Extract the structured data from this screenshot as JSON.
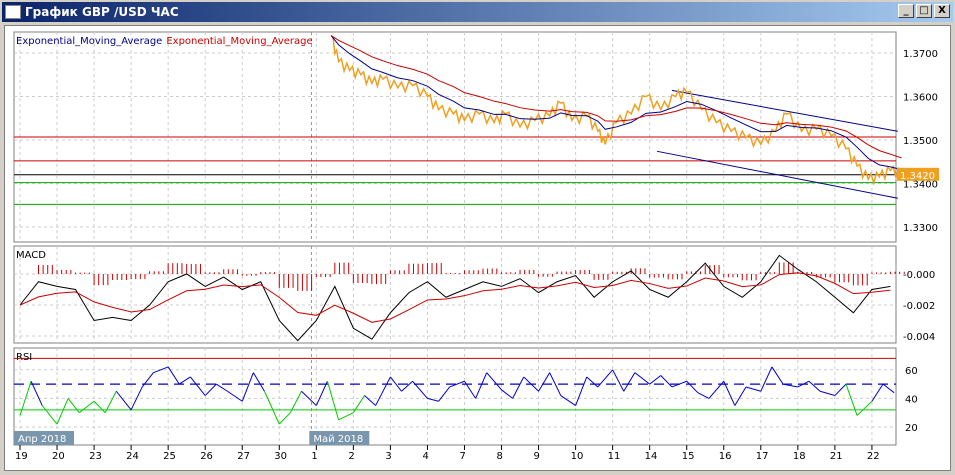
{
  "window": {
    "title": "График GBP /USD  ЧАС",
    "minimize": "_",
    "maximize": "□",
    "close": "X"
  },
  "main": {
    "legend": [
      {
        "text": "Exponential_Moving_Average",
        "color": "#00008b"
      },
      {
        "text": "Exponential_Moving_Average",
        "color": "#cc0000"
      }
    ],
    "y_ticks": [
      "1.3700",
      "1.3600",
      "1.3500",
      "1.3400",
      "1.3300"
    ],
    "current_price": "1.3420"
  },
  "macd": {
    "label": "MACD",
    "y_ticks": [
      "-0.000",
      "-0.002",
      "-0.004"
    ]
  },
  "rsi": {
    "label": "RSI",
    "y_ticks": [
      "60",
      "40",
      "20"
    ]
  },
  "x_axis": {
    "ticks": [
      "19",
      "20",
      "23",
      "24",
      "25",
      "26",
      "27",
      "30",
      "1",
      "2",
      "3",
      "4",
      "7",
      "8",
      "9",
      "10",
      "11",
      "14",
      "15",
      "16",
      "17",
      "18",
      "21",
      "22"
    ],
    "month_labels": [
      {
        "text": "Апр 2018",
        "idx": 0
      },
      {
        "text": "Май 2018",
        "idx": 8
      }
    ]
  },
  "chart_data": [
    {
      "type": "line",
      "title": "GBP/USD H1",
      "ylim": [
        1.325,
        1.374
      ],
      "price": [
        [
          8.4,
          1.374
        ],
        [
          8.6,
          1.368
        ],
        [
          8.9,
          1.366
        ],
        [
          9.2,
          1.365
        ],
        [
          9.5,
          1.363
        ],
        [
          9.8,
          1.364
        ],
        [
          10.2,
          1.362
        ],
        [
          10.6,
          1.3625
        ],
        [
          11,
          1.36
        ],
        [
          11.3,
          1.357
        ],
        [
          11.7,
          1.356
        ],
        [
          12,
          1.3545
        ],
        [
          12.4,
          1.356
        ],
        [
          12.8,
          1.354
        ],
        [
          13.1,
          1.356
        ],
        [
          13.5,
          1.353
        ],
        [
          13.9,
          1.3545
        ],
        [
          14.3,
          1.3555
        ],
        [
          14.6,
          1.3585
        ],
        [
          14.9,
          1.3545
        ],
        [
          15.3,
          1.3555
        ],
        [
          15.6,
          1.352
        ],
        [
          15.8,
          1.349
        ],
        [
          16.1,
          1.354
        ],
        [
          16.5,
          1.356
        ],
        [
          16.9,
          1.36
        ],
        [
          17.3,
          1.357
        ],
        [
          17.7,
          1.36
        ],
        [
          18,
          1.361
        ],
        [
          18.4,
          1.357
        ],
        [
          18.8,
          1.354
        ],
        [
          19.2,
          1.352
        ],
        [
          19.6,
          1.3505
        ],
        [
          20,
          1.349
        ],
        [
          20.4,
          1.352
        ],
        [
          20.7,
          1.356
        ],
        [
          21.1,
          1.352
        ],
        [
          21.5,
          1.3525
        ],
        [
          21.9,
          1.351
        ],
        [
          22.3,
          1.348
        ],
        [
          22.6,
          1.344
        ],
        [
          22.9,
          1.341
        ],
        [
          23.2,
          1.3415
        ],
        [
          23.5,
          1.343
        ],
        [
          23.8,
          1.342
        ]
      ],
      "hlines": [
        {
          "value": 1.3507,
          "color": "#cc0000"
        },
        {
          "value": 1.3452,
          "color": "#cc0000"
        },
        {
          "value": 1.342,
          "color": "#000000"
        },
        {
          "value": 1.3402,
          "color": "#00aa00"
        },
        {
          "value": 1.3352,
          "color": "#00aa00"
        }
      ],
      "trendlines": [
        {
          "from": [
            17.6,
            1.3614
          ],
          "to": [
            23.7,
            1.352
          ],
          "color": "#00008b"
        },
        {
          "from": [
            17.2,
            1.3474
          ],
          "to": [
            23.7,
            1.3366
          ],
          "color": "#00008b"
        }
      ]
    },
    {
      "type": "line",
      "title": "MACD",
      "ylim": [
        -0.0043,
        0.0008
      ],
      "macd": [
        [
          0,
          -0.002
        ],
        [
          0.5,
          -0.0005
        ],
        [
          1,
          -0.0008
        ],
        [
          1.5,
          -0.001
        ],
        [
          2,
          -0.003
        ],
        [
          2.5,
          -0.0028
        ],
        [
          3,
          -0.003
        ],
        [
          3.5,
          -0.002
        ],
        [
          4,
          -0.0005
        ],
        [
          4.5,
          0
        ],
        [
          5,
          -0.0008
        ],
        [
          5.5,
          -0.0002
        ],
        [
          6,
          -0.001
        ],
        [
          6.5,
          -0.0005
        ],
        [
          7,
          -0.003
        ],
        [
          7.5,
          -0.0043
        ],
        [
          8,
          -0.003
        ],
        [
          8.5,
          -0.0008
        ],
        [
          9,
          -0.0035
        ],
        [
          9.5,
          -0.0042
        ],
        [
          10,
          -0.0025
        ],
        [
          10.5,
          -0.0012
        ],
        [
          11,
          -0.0005
        ],
        [
          11.5,
          -0.0015
        ],
        [
          12,
          -0.001
        ],
        [
          12.5,
          -0.0005
        ],
        [
          13,
          -0.0008
        ],
        [
          13.5,
          -0.0003
        ],
        [
          14,
          -0.0012
        ],
        [
          14.5,
          -0.0005
        ],
        [
          15,
          -0.0001
        ],
        [
          15.5,
          -0.0015
        ],
        [
          16,
          -0.0005
        ],
        [
          16.5,
          0.0002
        ],
        [
          17,
          -0.001
        ],
        [
          17.5,
          -0.0015
        ],
        [
          18,
          -0.0005
        ],
        [
          18.5,
          0.0007
        ],
        [
          19,
          -0.0008
        ],
        [
          19.5,
          -0.0015
        ],
        [
          20,
          -0.0005
        ],
        [
          20.5,
          0.0012
        ],
        [
          21,
          0.0003
        ],
        [
          21.5,
          -0.0005
        ],
        [
          22,
          -0.0015
        ],
        [
          22.5,
          -0.0025
        ],
        [
          23,
          -0.001
        ],
        [
          23.5,
          -0.0008
        ]
      ]
    },
    {
      "type": "line",
      "title": "RSI",
      "ylim": [
        15,
        70
      ],
      "levels": [
        {
          "value": 70,
          "color": "#cc0000"
        },
        {
          "value": 50,
          "color": "#0000cc",
          "dashed": true
        },
        {
          "value": 30,
          "color": "#00cc00"
        }
      ],
      "rsi": [
        [
          0,
          28
        ],
        [
          0.3,
          52
        ],
        [
          0.6,
          35
        ],
        [
          1,
          22
        ],
        [
          1.3,
          40
        ],
        [
          1.6,
          30
        ],
        [
          2,
          38
        ],
        [
          2.3,
          30
        ],
        [
          2.6,
          45
        ],
        [
          3,
          32
        ],
        [
          3.3,
          48
        ],
        [
          3.6,
          58
        ],
        [
          4,
          62
        ],
        [
          4.3,
          50
        ],
        [
          4.6,
          55
        ],
        [
          5,
          42
        ],
        [
          5.3,
          50
        ],
        [
          5.6,
          45
        ],
        [
          6,
          38
        ],
        [
          6.3,
          58
        ],
        [
          6.6,
          45
        ],
        [
          7,
          22
        ],
        [
          7.3,
          30
        ],
        [
          7.6,
          45
        ],
        [
          8,
          35
        ],
        [
          8.3,
          52
        ],
        [
          8.6,
          25
        ],
        [
          9,
          30
        ],
        [
          9.3,
          42
        ],
        [
          9.6,
          35
        ],
        [
          10,
          55
        ],
        [
          10.3,
          45
        ],
        [
          10.6,
          52
        ],
        [
          11,
          40
        ],
        [
          11.3,
          38
        ],
        [
          11.6,
          48
        ],
        [
          12,
          52
        ],
        [
          12.3,
          40
        ],
        [
          12.6,
          58
        ],
        [
          13,
          46
        ],
        [
          13.3,
          40
        ],
        [
          13.6,
          55
        ],
        [
          14,
          45
        ],
        [
          14.3,
          58
        ],
        [
          14.6,
          42
        ],
        [
          15,
          35
        ],
        [
          15.3,
          55
        ],
        [
          15.6,
          48
        ],
        [
          16,
          60
        ],
        [
          16.3,
          45
        ],
        [
          16.6,
          58
        ],
        [
          17,
          50
        ],
        [
          17.3,
          56
        ],
        [
          17.6,
          48
        ],
        [
          18,
          52
        ],
        [
          18.3,
          44
        ],
        [
          18.6,
          40
        ],
        [
          19,
          52
        ],
        [
          19.3,
          35
        ],
        [
          19.6,
          48
        ],
        [
          20,
          45
        ],
        [
          20.3,
          62
        ],
        [
          20.6,
          50
        ],
        [
          21,
          48
        ],
        [
          21.3,
          52
        ],
        [
          21.6,
          45
        ],
        [
          22,
          42
        ],
        [
          22.3,
          50
        ],
        [
          22.6,
          28
        ],
        [
          23,
          38
        ],
        [
          23.3,
          50
        ],
        [
          23.6,
          44
        ]
      ]
    }
  ]
}
